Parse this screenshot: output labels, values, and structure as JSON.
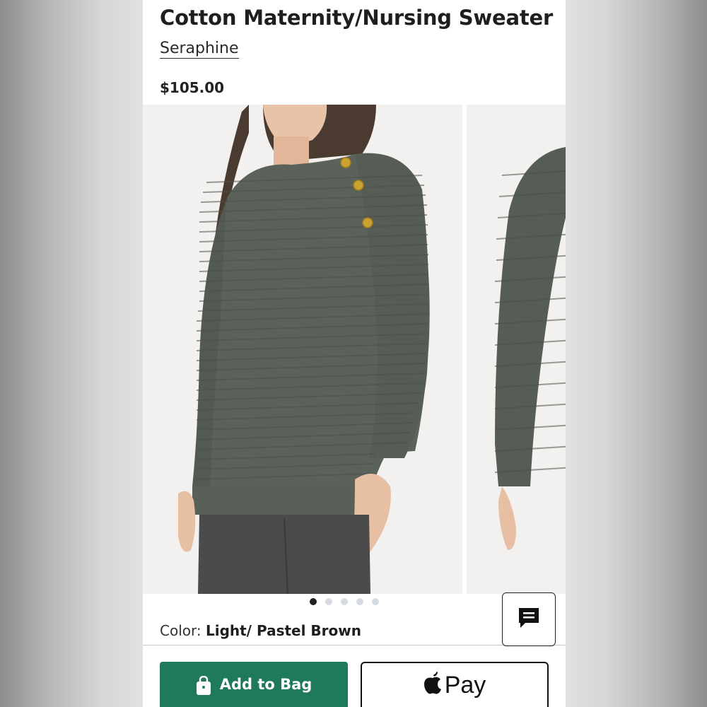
{
  "product": {
    "title": "Cotton Maternity/Nursing Sweater",
    "brand": "Seraphine",
    "price": "$105.00"
  },
  "carousel": {
    "image_count": 5,
    "active_index": 0,
    "colors": {
      "sweater": "#5b625a",
      "background": "#f2f1ef",
      "buttons": "#c9a233",
      "jeans": "#4b4b4b"
    }
  },
  "color_selector": {
    "label": "Color:",
    "value": "Light/ Pastel Brown"
  },
  "chat": {
    "icon": "chat-bubble-icon"
  },
  "actions": {
    "add_to_bag_label": "Add to Bag",
    "add_to_bag_icon": "shopping-bag-icon",
    "apple_pay_label": "Pay",
    "apple_pay_icon": "apple-logo-icon",
    "accent_color": "#1f7a5c"
  }
}
